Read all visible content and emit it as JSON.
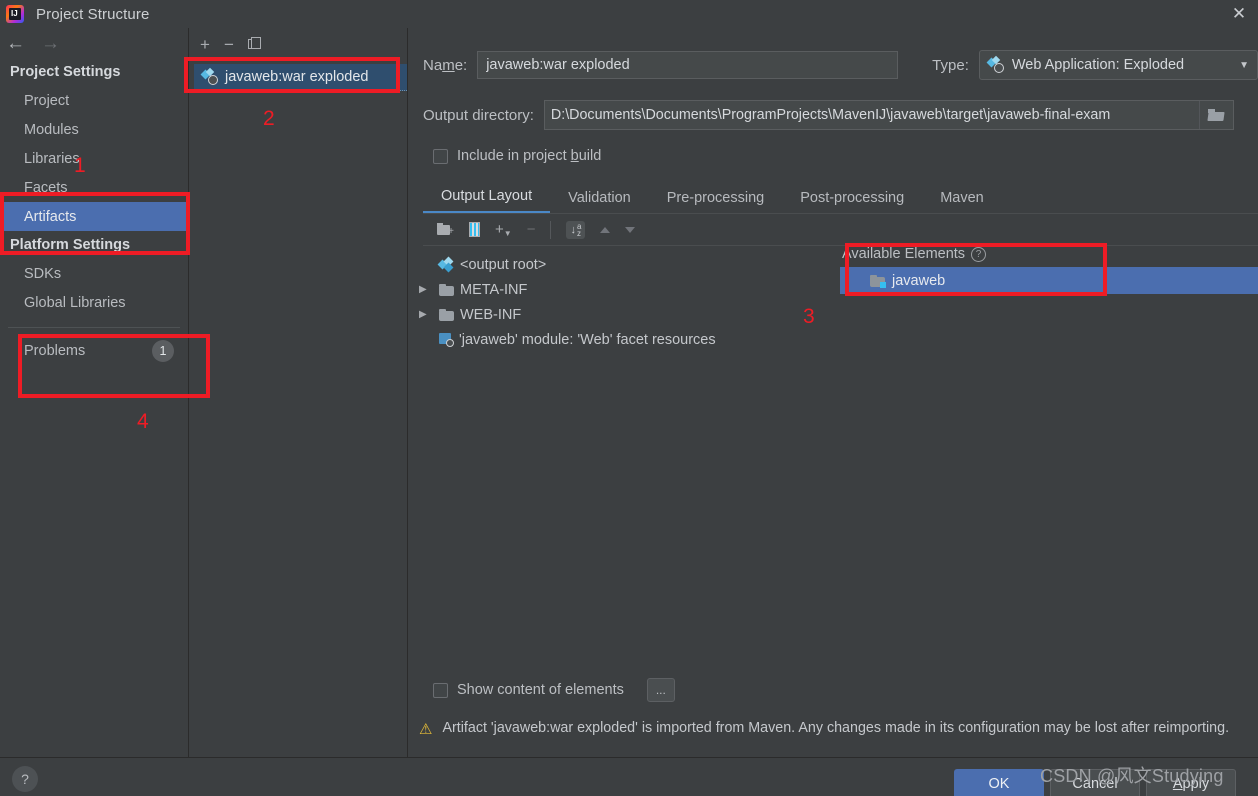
{
  "window": {
    "title": "Project Structure",
    "logo_icon": "intellij-idea-logo",
    "close_icon": "close-icon"
  },
  "sidebar": {
    "back_icon": "arrow-left-icon",
    "forward_icon": "arrow-right-icon",
    "project_settings_header": "Project Settings",
    "platform_settings_header": "Platform Settings",
    "project_items": [
      {
        "label": "Project",
        "selected": false
      },
      {
        "label": "Modules",
        "selected": false
      },
      {
        "label": "Libraries",
        "selected": false
      },
      {
        "label": "Facets",
        "selected": false
      },
      {
        "label": "Artifacts",
        "selected": true
      }
    ],
    "platform_items": [
      {
        "label": "SDKs",
        "selected": false
      },
      {
        "label": "Global Libraries",
        "selected": false
      }
    ],
    "problems": {
      "label": "Problems",
      "count": "1"
    }
  },
  "artifacts_panel": {
    "toolbar": {
      "add_icon": "plus-icon",
      "remove_icon": "minus-icon",
      "copy_icon": "copy-icon"
    },
    "items": [
      {
        "label": "javaweb:war exploded",
        "icon": "web-application-exploded-icon",
        "selected": true
      }
    ]
  },
  "detail": {
    "name_label": "Name:",
    "name_value": "javaweb:war exploded",
    "type_label": "Type:",
    "type_value": "Web Application: Exploded",
    "type_icon": "web-application-exploded-icon",
    "output_dir_label": "Output directory:",
    "output_dir_value": "D:\\Documents\\Documents\\ProgramProjects\\MavenIJ\\javaweb\\target\\javaweb-final-exam",
    "browse_icon": "folder-browse-icon",
    "include_in_build_label": "Include in project build",
    "include_in_build_checked": false,
    "tabs": [
      {
        "label": "Output Layout",
        "active": true
      },
      {
        "label": "Validation",
        "active": false
      },
      {
        "label": "Pre-processing",
        "active": false
      },
      {
        "label": "Post-processing",
        "active": false
      },
      {
        "label": "Maven",
        "active": false
      }
    ],
    "layout_toolbar": {
      "new_directory_icon": "new-folder-icon",
      "new_archive_icon": "archive-icon",
      "add_icon": "plus-dropdown-icon",
      "remove_icon": "minus-icon",
      "sort_icon": "sort-alphabetical-icon",
      "move_up_icon": "arrow-up-icon",
      "move_down_icon": "arrow-down-icon"
    },
    "tree": [
      {
        "label": "<output root>",
        "icon": "artifact-root-icon",
        "expandable": false,
        "indent": 0
      },
      {
        "label": "META-INF",
        "icon": "folder-icon",
        "expandable": true,
        "indent": 0
      },
      {
        "label": "WEB-INF",
        "icon": "folder-icon",
        "expandable": true,
        "indent": 0
      },
      {
        "label": "'javaweb' module: 'Web' facet resources",
        "icon": "module-facet-icon",
        "expandable": false,
        "indent": 1
      }
    ],
    "available_elements": {
      "header": "Available Elements",
      "help_icon": "question-mark-icon",
      "items": [
        {
          "label": "javaweb",
          "icon": "module-folder-icon",
          "selected": true
        }
      ]
    },
    "show_content_label": "Show content of elements",
    "show_content_checked": false,
    "ellipsis_button_label": "...",
    "warning_icon": "warning-triangle-icon",
    "warning_text": "Artifact 'javaweb:war exploded' is imported from Maven. Any changes made in its configuration may be lost after reimporting."
  },
  "footer": {
    "help_label": "?",
    "ok_label": "OK",
    "cancel_label": "Cancel",
    "apply_label": "Apply"
  },
  "watermark": "CSDN @风文Studying",
  "annotations": [
    {
      "number": "1"
    },
    {
      "number": "2"
    },
    {
      "number": "3"
    },
    {
      "number": "4"
    }
  ],
  "colors": {
    "accent_blue": "#4b6eaf",
    "annotation_red": "#ee1c25",
    "window_bg": "#3c3f41",
    "warning_yellow": "#e8bf38"
  }
}
